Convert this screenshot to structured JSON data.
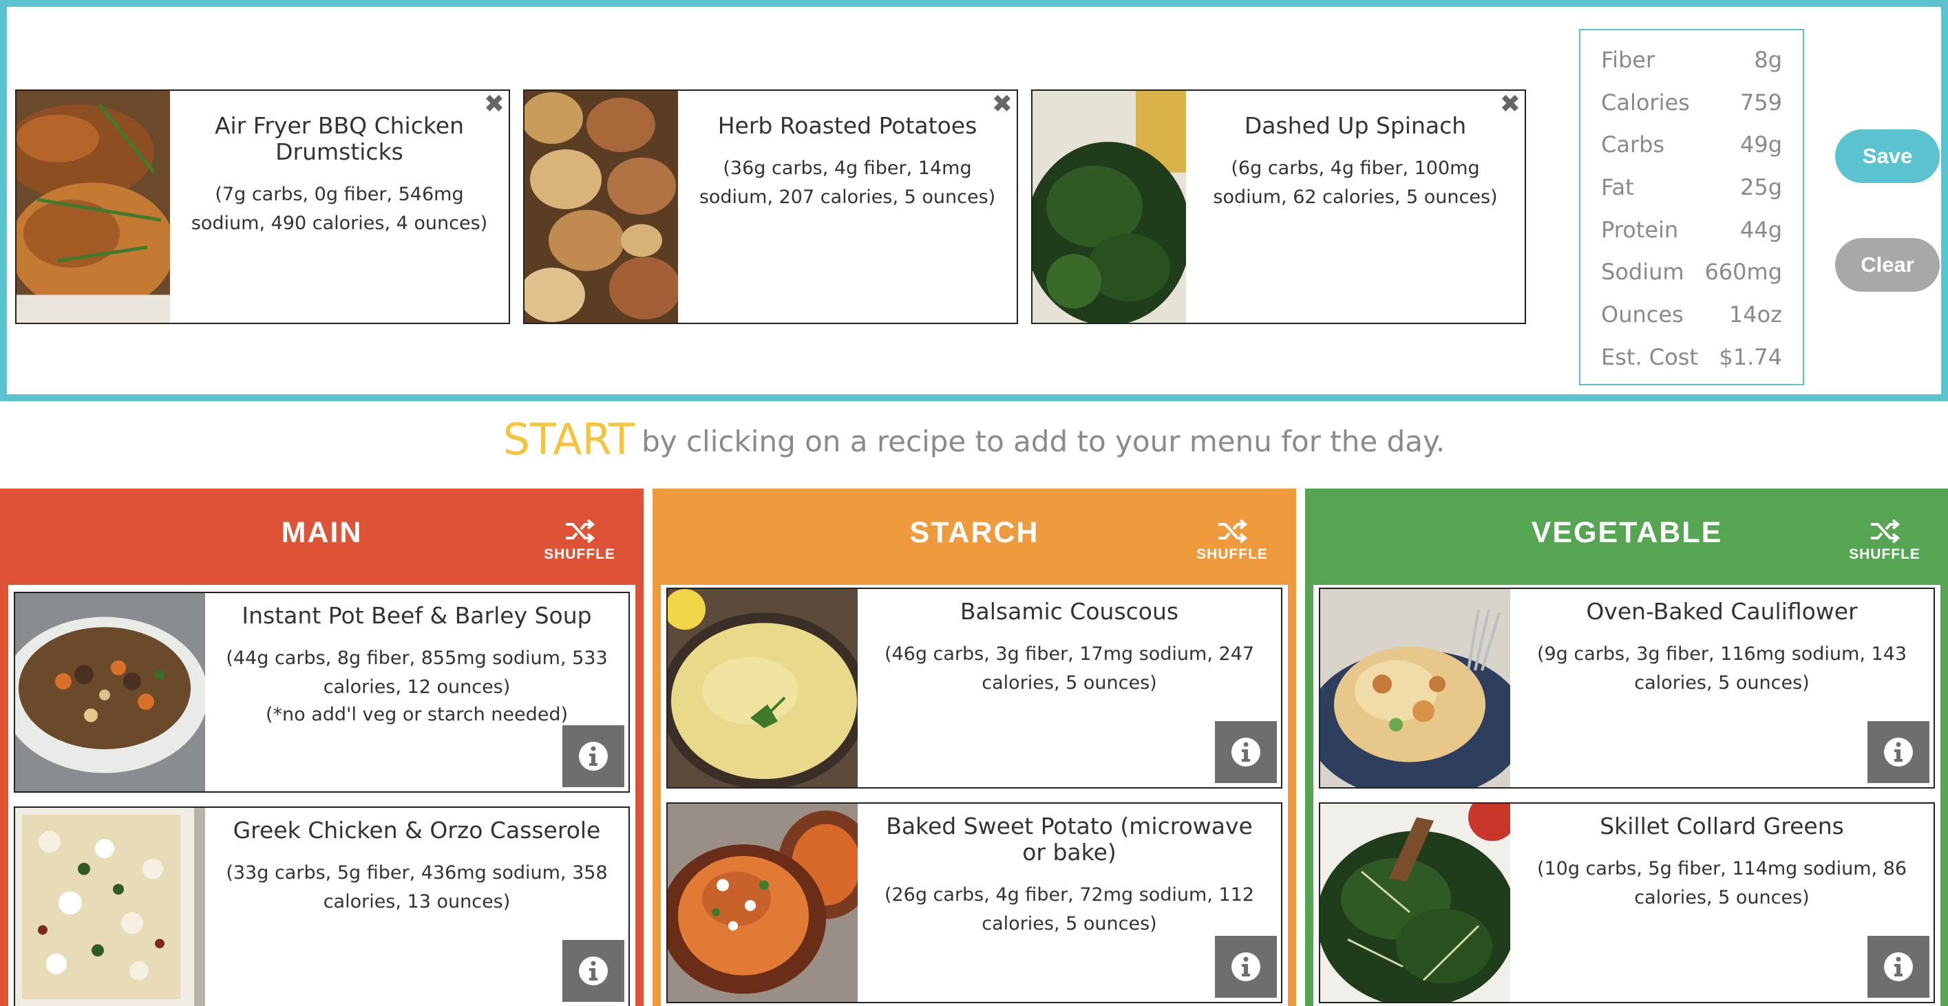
{
  "selected_menu": [
    {
      "name": "Air Fryer BBQ Chicken Drumsticks",
      "nutrition": "(7g carbs, 0g fiber, 546mg sodium, 490 calories, 4 ounces)",
      "image": "bbq-chicken-photo"
    },
    {
      "name": "Herb Roasted Potatoes",
      "nutrition": "(36g carbs, 4g fiber, 14mg sodium, 207 calories, 5 ounces)",
      "image": "roasted-potatoes-photo"
    },
    {
      "name": "Dashed Up Spinach",
      "nutrition": "(6g carbs, 4g fiber, 100mg sodium, 62 calories, 5 ounces)",
      "image": "spinach-photo"
    }
  ],
  "close_icon": "close-icon",
  "totals": [
    {
      "label": "Fiber",
      "value": "8g"
    },
    {
      "label": "Calories",
      "value": "759"
    },
    {
      "label": "Carbs",
      "value": "49g"
    },
    {
      "label": "Fat",
      "value": "25g"
    },
    {
      "label": "Protein",
      "value": "44g"
    },
    {
      "label": "Sodium",
      "value": "660mg"
    },
    {
      "label": "Ounces",
      "value": "14oz"
    },
    {
      "label": "Est. Cost",
      "value": "$1.74"
    }
  ],
  "buttons": {
    "save": "Save",
    "clear": "Clear"
  },
  "start": {
    "highlight": "START",
    "text": "by clicking on a recipe to add to your menu for the day."
  },
  "shuffle_label": "SHUFFLE",
  "columns": [
    {
      "title": "MAIN",
      "color": "#de5336",
      "recipes": [
        {
          "name": "Instant Pot Beef & Barley Soup",
          "nutrition": "(44g carbs, 8g fiber, 855mg sodium, 533 calories, 12 ounces)",
          "note": "(*no add'l veg or starch needed)",
          "image": "beef-barley-soup-photo"
        },
        {
          "name": "Greek Chicken & Orzo Casserole",
          "nutrition": "(33g carbs, 5g fiber, 436mg sodium, 358 calories, 13 ounces)",
          "image": "chicken-orzo-casserole-photo"
        }
      ]
    },
    {
      "title": "STARCH",
      "color": "#ef9b3d",
      "recipes": [
        {
          "name": "Balsamic Couscous",
          "nutrition": "(46g carbs, 3g fiber, 17mg sodium, 247 calories, 5 ounces)",
          "image": "couscous-photo"
        },
        {
          "name": "Baked Sweet Potato (microwave or bake)",
          "nutrition": "(26g carbs, 4g fiber, 72mg sodium, 112 calories, 5 ounces)",
          "image": "sweet-potato-photo"
        }
      ]
    },
    {
      "title": "VEGETABLE",
      "color": "#56a553",
      "recipes": [
        {
          "name": "Oven-Baked Cauliflower",
          "nutrition": "(9g carbs, 3g fiber, 116mg sodium, 143 calories, 5 ounces)",
          "image": "cauliflower-photo"
        },
        {
          "name": "Skillet Collard Greens",
          "nutrition": "(10g carbs, 5g fiber, 114mg sodium, 86 calories, 5 ounces)",
          "image": "collard-greens-photo"
        }
      ]
    }
  ]
}
